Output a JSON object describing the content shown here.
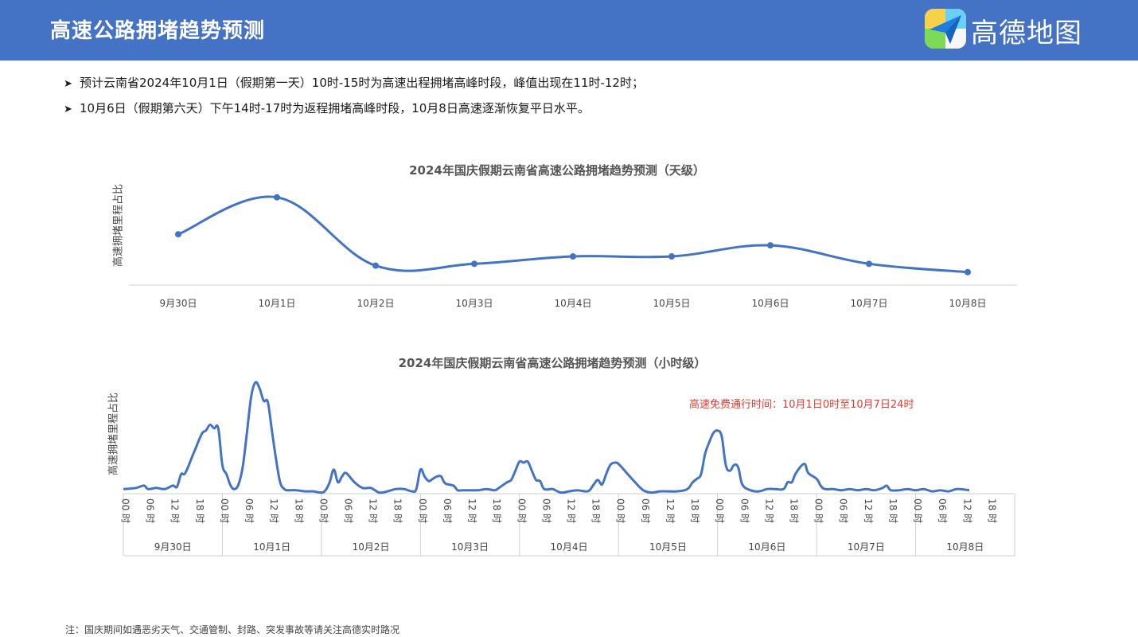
{
  "header": {
    "title": "高速公路拥堵趋势预测",
    "logo_text": "高德地图",
    "background_color": "#4472c4"
  },
  "bullets": [
    "预计云南省2024年10月1日（假期第一天）10时-15时为高速出程拥堵高峰时段，峰值出现在11时-12时；",
    "10月6日（假期第六天）下午14时-17时为返程拥堵高峰时段，10月8日高速逐渐恢复平日水平。"
  ],
  "bullet_marker": "➤",
  "footnote": "注：国庆期间如遇恶劣天气、交通管制、封路、突发事故等请关注高德实时路况",
  "chart_data": [
    {
      "type": "line",
      "title": "2024年国庆假期云南省高速公路拥堵趋势预测（天级）",
      "ylabel": "高速拥堵里程占比",
      "categories": [
        "9月30日",
        "10月1日",
        "10月2日",
        "10月3日",
        "10月4日",
        "10月5日",
        "10月6日",
        "10月7日",
        "10月8日"
      ],
      "values": [
        0.55,
        0.95,
        0.21,
        0.23,
        0.31,
        0.31,
        0.43,
        0.23,
        0.14
      ],
      "ylim": [
        0,
        1
      ],
      "grid": false,
      "markers": true,
      "smooth": true,
      "line_color": "#4472c4"
    },
    {
      "type": "line",
      "title": "2024年国庆假期云南省高速公路拥堵趋势预测（小时级）",
      "ylabel": "高速拥堵里程占比",
      "annotation": "高速免费通行时间：10月1日0时至10月7日24时",
      "annotation_color": "#e03c31",
      "days": [
        "9月30日",
        "10月1日",
        "10月2日",
        "10月3日",
        "10月4日",
        "10月5日",
        "10月6日",
        "10月7日",
        "10月8日"
      ],
      "hour_ticks": [
        "00 时",
        "06 时",
        "12 时",
        "18 时"
      ],
      "hour_tick_values": [
        0,
        6,
        12,
        18
      ],
      "x_unit": "hour",
      "ylim": [
        0,
        1
      ],
      "grid": false,
      "smooth": true,
      "line_color": "#4472c4",
      "series": [
        {
          "values": [
            [
              0,
              0.04
            ],
            [
              3,
              0.05
            ],
            [
              5,
              0.07
            ],
            [
              6,
              0.04
            ],
            [
              8,
              0.05
            ],
            [
              10,
              0.04
            ],
            [
              12,
              0.07
            ],
            [
              13,
              0.06
            ],
            [
              14,
              0.17
            ],
            [
              15,
              0.18
            ],
            [
              17,
              0.35
            ],
            [
              19,
              0.52
            ],
            [
              20,
              0.55
            ],
            [
              21,
              0.6
            ],
            [
              22,
              0.57
            ],
            [
              23,
              0.57
            ],
            [
              24,
              0.25
            ],
            [
              25,
              0.17
            ],
            [
              26,
              0.07
            ],
            [
              27,
              0.04
            ],
            [
              28,
              0.09
            ],
            [
              29,
              0.25
            ],
            [
              30,
              0.55
            ],
            [
              31,
              0.85
            ],
            [
              32,
              0.97
            ],
            [
              33,
              0.92
            ],
            [
              34,
              0.81
            ],
            [
              35,
              0.8
            ],
            [
              36,
              0.55
            ],
            [
              37,
              0.3
            ],
            [
              38,
              0.1
            ],
            [
              39,
              0.04
            ],
            [
              40,
              0.03
            ],
            [
              42,
              0.03
            ],
            [
              44,
              0.02
            ],
            [
              46,
              0.02
            ],
            [
              48,
              0.01
            ],
            [
              49,
              0.03
            ],
            [
              50,
              0.1
            ],
            [
              51,
              0.21
            ],
            [
              52,
              0.1
            ],
            [
              53,
              0.15
            ],
            [
              54,
              0.18
            ],
            [
              56,
              0.1
            ],
            [
              58,
              0.05
            ],
            [
              60,
              0.05
            ],
            [
              62,
              0.01
            ],
            [
              64,
              0.02
            ],
            [
              66,
              0.04
            ],
            [
              68,
              0.04
            ],
            [
              70,
              0.02
            ],
            [
              71,
              0.04
            ],
            [
              72,
              0.21
            ],
            [
              73,
              0.15
            ],
            [
              74,
              0.11
            ],
            [
              75,
              0.13
            ],
            [
              76,
              0.15
            ],
            [
              77,
              0.15
            ],
            [
              78,
              0.09
            ],
            [
              80,
              0.07
            ],
            [
              81,
              0.03
            ],
            [
              82,
              0.03
            ],
            [
              84,
              0.03
            ],
            [
              86,
              0.03
            ],
            [
              88,
              0.04
            ],
            [
              90,
              0.03
            ],
            [
              91,
              0.05
            ],
            [
              93,
              0.1
            ],
            [
              94,
              0.12
            ],
            [
              95,
              0.2
            ],
            [
              96,
              0.28
            ],
            [
              97,
              0.27
            ],
            [
              98,
              0.28
            ],
            [
              99,
              0.2
            ],
            [
              100,
              0.12
            ],
            [
              101,
              0.11
            ],
            [
              102,
              0.04
            ],
            [
              104,
              0.04
            ],
            [
              106,
              0.01
            ],
            [
              108,
              0.02
            ],
            [
              110,
              0.03
            ],
            [
              112,
              0.02
            ],
            [
              113,
              0.03
            ],
            [
              114,
              0.08
            ],
            [
              115,
              0.12
            ],
            [
              116,
              0.08
            ],
            [
              117,
              0.17
            ],
            [
              118,
              0.25
            ],
            [
              119,
              0.27
            ],
            [
              120,
              0.26
            ],
            [
              122,
              0.18
            ],
            [
              124,
              0.1
            ],
            [
              126,
              0.03
            ],
            [
              128,
              0.01
            ],
            [
              130,
              0.02
            ],
            [
              132,
              0.02
            ],
            [
              134,
              0.02
            ],
            [
              136,
              0.03
            ],
            [
              137,
              0.05
            ],
            [
              138,
              0.1
            ],
            [
              139,
              0.13
            ],
            [
              140,
              0.17
            ],
            [
              141,
              0.35
            ],
            [
              142,
              0.45
            ],
            [
              143,
              0.53
            ],
            [
              144,
              0.55
            ],
            [
              145,
              0.5
            ],
            [
              146,
              0.25
            ],
            [
              147,
              0.2
            ],
            [
              148,
              0.25
            ],
            [
              149,
              0.23
            ],
            [
              150,
              0.08
            ],
            [
              152,
              0.03
            ],
            [
              154,
              0.02
            ],
            [
              156,
              0.04
            ],
            [
              158,
              0.04
            ],
            [
              160,
              0.04
            ],
            [
              161,
              0.1
            ],
            [
              162,
              0.1
            ],
            [
              163,
              0.18
            ],
            [
              165,
              0.26
            ],
            [
              166,
              0.18
            ],
            [
              168,
              0.13
            ],
            [
              169,
              0.07
            ],
            [
              170,
              0.04
            ],
            [
              172,
              0.04
            ],
            [
              174,
              0.03
            ],
            [
              176,
              0.04
            ],
            [
              178,
              0.03
            ],
            [
              180,
              0.04
            ],
            [
              182,
              0.03
            ],
            [
              184,
              0.05
            ],
            [
              185,
              0.07
            ],
            [
              186,
              0.03
            ],
            [
              188,
              0.03
            ],
            [
              190,
              0.04
            ],
            [
              192,
              0.03
            ],
            [
              194,
              0.04
            ],
            [
              196,
              0.02
            ],
            [
              198,
              0.03
            ],
            [
              200,
              0.02
            ],
            [
              202,
              0.04
            ],
            [
              205,
              0.03
            ]
          ]
        }
      ]
    }
  ]
}
